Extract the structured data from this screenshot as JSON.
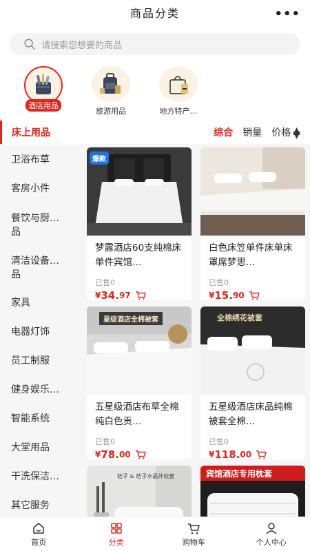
{
  "header": {
    "title": "商品分类",
    "more": "•••"
  },
  "search": {
    "placeholder": "请搜索您想要的商品"
  },
  "categories": [
    {
      "label": "酒店用品",
      "icon": "hotel-supplies-icon",
      "active": true
    },
    {
      "label": "旅游用品",
      "icon": "travel-bag-icon",
      "active": false
    },
    {
      "label": "地方特产…",
      "icon": "shopping-bag-icon",
      "active": false
    }
  ],
  "sidebar": {
    "active": "床上用品",
    "items": [
      "卫浴布草",
      "客房小件",
      "餐饮与厨…\n品",
      "清洁设备…\n品",
      "家具",
      "电器灯饰",
      "员工制服",
      "健身娱乐…",
      "智能系统",
      "大堂用品",
      "干洗保洁…",
      "其它服务"
    ]
  },
  "sort": {
    "comprehensive": "综合",
    "sales": "销量",
    "price": "价格"
  },
  "products": [
    {
      "name": "梦露酒店60支纯棉床单件宾馆…",
      "sold": "已售0",
      "yen": "¥",
      "price_int": "34.",
      "price_dec": "97",
      "badge": "爆款"
    },
    {
      "name": "白色床笠单件床单床罩席梦思…",
      "sold": "已售0",
      "yen": "¥",
      "price_int": "15.",
      "price_dec": "90",
      "badge": ""
    },
    {
      "name": "五星级酒店布草全棉纯白色贡…",
      "sold": "已售0",
      "yen": "¥",
      "price_int": "78.",
      "price_dec": "00",
      "badge": "星级酒店全棉被套"
    },
    {
      "name": "五星级酒店床品纯棉被套全棉…",
      "sold": "已售0",
      "yen": "¥",
      "price_int": "118.",
      "price_dec": "00",
      "badge": "全棉绣花被套"
    },
    {
      "name": "",
      "sold": "",
      "badge": "桔子 & 桔子水晶外枕套"
    },
    {
      "name": "",
      "sold": "",
      "badge": "宾馆酒店专用枕套"
    }
  ],
  "tabbar": [
    {
      "label": "首页",
      "active": false
    },
    {
      "label": "分类",
      "active": true
    },
    {
      "label": "购物车",
      "active": false
    },
    {
      "label": "个人中心",
      "active": false
    }
  ],
  "colors": {
    "accent": "#e1251b",
    "background": "#f6f6f6"
  }
}
